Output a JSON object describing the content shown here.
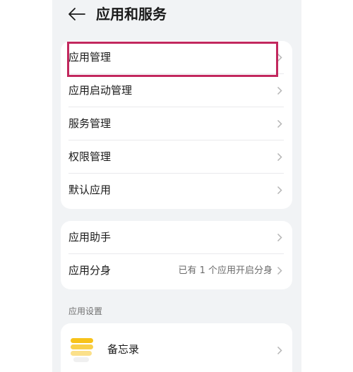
{
  "header": {
    "title": "应用和服务"
  },
  "group1": {
    "items": [
      {
        "label": "应用管理"
      },
      {
        "label": "应用启动管理"
      },
      {
        "label": "服务管理"
      },
      {
        "label": "权限管理"
      },
      {
        "label": "默认应用"
      }
    ]
  },
  "group2": {
    "items": [
      {
        "label": "应用助手"
      },
      {
        "label": "应用分身",
        "value": "已有 1 个应用开启分身"
      }
    ]
  },
  "app_settings": {
    "section_label": "应用设置",
    "apps": [
      {
        "label": "备忘录",
        "icon": "memo-app-icon"
      }
    ]
  },
  "colors": {
    "highlight_border": "#c2285e",
    "background": "#f1f3f5",
    "card": "#ffffff",
    "memo_icon_yellow": "#f7c21a"
  }
}
